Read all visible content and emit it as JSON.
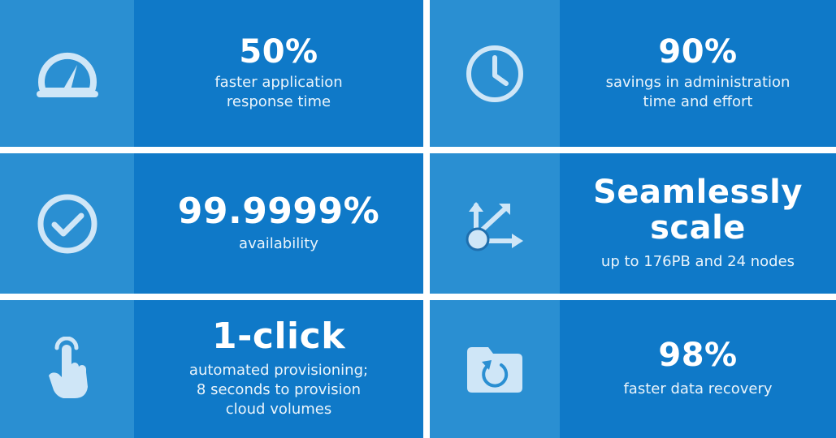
{
  "colors": {
    "icon_panel": "#2a8fd2",
    "text_panel": "#0f79c8",
    "icon_fill": "#cfe6f7",
    "text": "#ffffff",
    "gap": "#ffffff"
  },
  "tiles": [
    {
      "icon": "speedometer-icon",
      "headline": "50%",
      "lines": [
        "faster application",
        "response time"
      ]
    },
    {
      "icon": "clock-icon",
      "headline": "90%",
      "lines": [
        "savings in administration",
        "time and effort"
      ]
    },
    {
      "icon": "checkmark-circle-icon",
      "headline": "99.9999%",
      "lines": [
        "availability"
      ]
    },
    {
      "icon": "scale-arrows-icon",
      "headline_lines": [
        "Seamlessly",
        "scale"
      ],
      "lines": [
        "up to 176PB and 24 nodes"
      ]
    },
    {
      "icon": "tap-hand-icon",
      "headline": "1-click",
      "lines": [
        "automated provisioning;",
        "8 seconds to provision",
        "cloud volumes"
      ]
    },
    {
      "icon": "folder-recovery-icon",
      "headline": "98%",
      "lines": [
        "faster data recovery"
      ]
    }
  ]
}
